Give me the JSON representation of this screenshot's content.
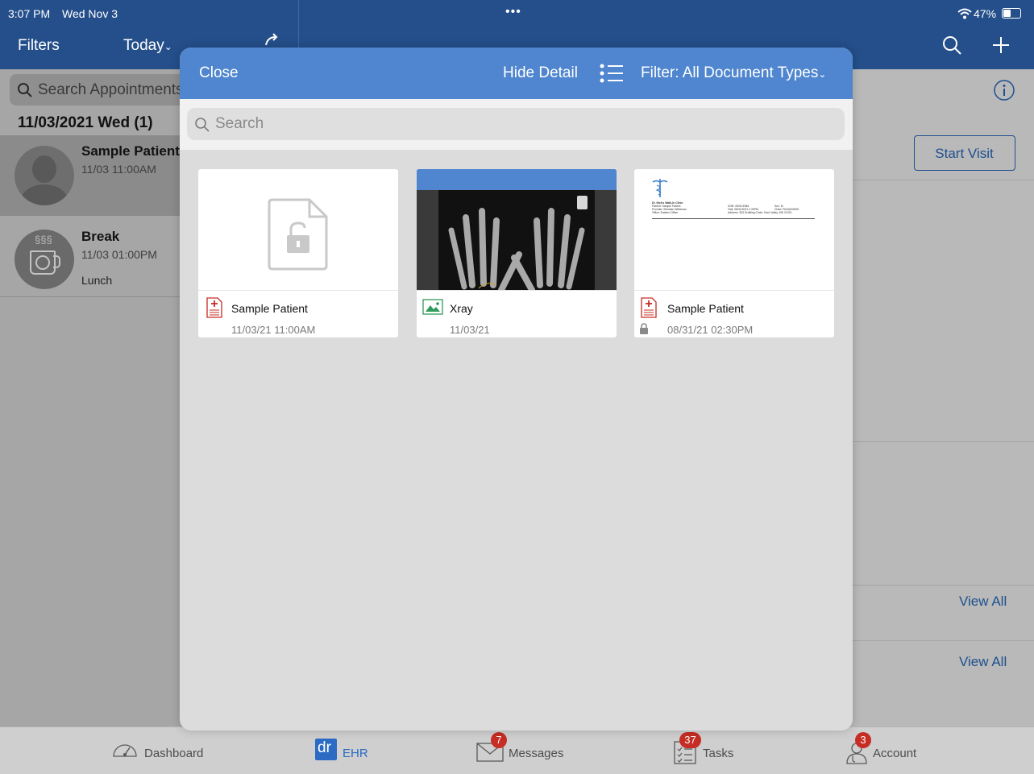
{
  "status_bar": {
    "time": "3:07 PM",
    "date": "Wed Nov 3",
    "battery": "47%"
  },
  "top_bar": {
    "filters": "Filters",
    "today": "Today"
  },
  "left_pane": {
    "search_placeholder": "Search Appointments",
    "date_header": "11/03/2021 Wed (1)",
    "appointments": [
      {
        "name": "Sample Patient",
        "time": "11/03 11:00AM",
        "note": ""
      },
      {
        "name": "Break",
        "time": "11/03 01:00PM",
        "note": "Lunch"
      }
    ]
  },
  "right_pane": {
    "start_visit": "Start Visit",
    "view_all_1": "View All",
    "view_all_2": "View All"
  },
  "modal": {
    "close": "Close",
    "hide_detail": "Hide Detail",
    "filter": "Filter: All Document Types",
    "search_placeholder": "Search",
    "documents": [
      {
        "title": "Sample Patient",
        "date": "11/03/21 11:00AM",
        "type_icon": "pdf-document-icon",
        "thumb": "lock-file-icon"
      },
      {
        "title": "Xray",
        "date": "11/03/21",
        "type_icon": "image-icon",
        "thumb": "xray-hands-image"
      },
      {
        "title": "Sample Patient",
        "date": "08/31/21 02:30PM",
        "type_icon": "pdf-document-icon",
        "thumb": "document-preview",
        "locked": true
      }
    ],
    "doc_preview": {
      "clinic": "Dr. Nick's Walk-In Clinic",
      "patient": "Patient: Sample Patient",
      "provider": "Provider: Brendan Wilkerson",
      "office": "Office: Eastern Office",
      "dob": "DOB: 06/01/1986",
      "visit": "Visit: 08/31/2021 2:30PM",
      "address": "Address: 303 Schilling Circle, Hunt Valley, MD 21031",
      "sex": "Sex: M",
      "chart": "Chart: PASA000000"
    }
  },
  "tab_bar": {
    "items": [
      {
        "label": "Dashboard",
        "icon": "speedometer-icon",
        "badge": ""
      },
      {
        "label": "EHR",
        "icon": "dr-logo-icon",
        "badge": ""
      },
      {
        "label": "Messages",
        "icon": "envelope-icon",
        "badge": "7"
      },
      {
        "label": "Tasks",
        "icon": "checklist-icon",
        "badge": "37"
      },
      {
        "label": "Account",
        "icon": "doctor-icon",
        "badge": "3"
      }
    ]
  },
  "colors": {
    "nav_blue": "#244f8a",
    "modal_header_blue": "#4f86cf",
    "badge_red": "#c62d24",
    "link_blue": "#1d64c2"
  }
}
